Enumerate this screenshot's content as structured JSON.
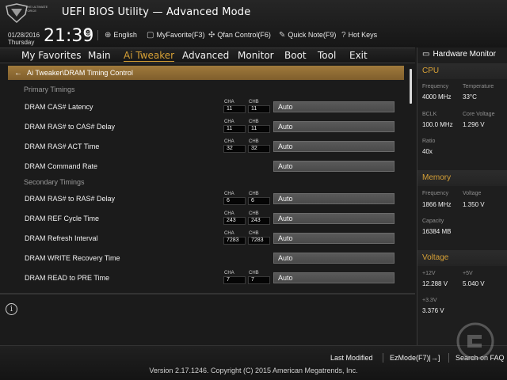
{
  "header": {
    "logo_text": "THE ULTIMATE FORCE",
    "title": "UEFI BIOS Utility — Advanced Mode",
    "date": "01/28/2016",
    "weekday": "Thursday",
    "time": "21:39",
    "tools": {
      "language": "English",
      "my_favorite": "MyFavorite(F3)",
      "qfan": "Qfan Control(F6)",
      "quick_note": "Quick Note(F9)",
      "hot_keys": "Hot Keys"
    }
  },
  "menu": {
    "items": [
      "My Favorites",
      "Main",
      "Ai Tweaker",
      "Advanced",
      "Monitor",
      "Boot",
      "Tool",
      "Exit"
    ],
    "active": "Ai Tweaker"
  },
  "breadcrumb": "Ai Tweaker\\DRAM Timing Control",
  "settings": {
    "primary_title": "Primary Timings",
    "secondary_title": "Secondary Timings",
    "cha_label": "CHA",
    "chb_label": "CHB",
    "rows": [
      {
        "label": "DRAM CAS# Latency",
        "cha": "11",
        "chb": "11",
        "value": "Auto"
      },
      {
        "label": "DRAM RAS# to CAS# Delay",
        "cha": "11",
        "chb": "11",
        "value": "Auto"
      },
      {
        "label": "DRAM RAS# ACT Time",
        "cha": "32",
        "chb": "32",
        "value": "Auto"
      },
      {
        "label": "DRAM Command Rate",
        "cha": "",
        "chb": "",
        "value": "Auto"
      },
      {
        "label": "DRAM RAS# to RAS# Delay",
        "cha": "6",
        "chb": "6",
        "value": "Auto"
      },
      {
        "label": "DRAM REF Cycle Time",
        "cha": "243",
        "chb": "243",
        "value": "Auto"
      },
      {
        "label": "DRAM Refresh Interval",
        "cha": "7283",
        "chb": "7283",
        "value": "Auto"
      },
      {
        "label": "DRAM WRITE Recovery Time",
        "cha": "",
        "chb": "",
        "value": "Auto"
      },
      {
        "label": "DRAM READ to PRE Time",
        "cha": "7",
        "chb": "7",
        "value": "Auto"
      }
    ]
  },
  "hw_monitor": {
    "title": "Hardware Monitor",
    "cpu": {
      "title": "CPU",
      "frequency_label": "Frequency",
      "frequency": "4000 MHz",
      "temperature_label": "Temperature",
      "temperature": "33°C",
      "bclk_label": "BCLK",
      "bclk": "100.0 MHz",
      "core_voltage_label": "Core Voltage",
      "core_voltage": "1.296 V",
      "ratio_label": "Ratio",
      "ratio": "40x"
    },
    "memory": {
      "title": "Memory",
      "frequency_label": "Frequency",
      "frequency": "1866 MHz",
      "voltage_label": "Voltage",
      "voltage": "1.350 V",
      "capacity_label": "Capacity",
      "capacity": "16384 MB"
    },
    "voltage": {
      "title": "Voltage",
      "v12_label": "+12V",
      "v12": "12.288 V",
      "v5_label": "+5V",
      "v5": "5.040 V",
      "v33_label": "+3.3V",
      "v33": "3.376 V"
    }
  },
  "footer": {
    "last_modified": "Last Modified",
    "ezmode": "EzMode(F7)|→]",
    "search_faq": "Search on FAQ",
    "version": "Version 2.17.1246. Copyright (C) 2015 American Megatrends, Inc."
  },
  "colors": {
    "accent": "#d6a036",
    "breadcrumb_bar": "#a07a3c",
    "background": "#1b1b1b"
  },
  "icons": [
    "gear-icon",
    "globe-icon",
    "favorite-icon",
    "fan-icon",
    "note-icon",
    "keyboard-icon",
    "monitor-icon",
    "back-arrow-icon",
    "info-icon"
  ]
}
